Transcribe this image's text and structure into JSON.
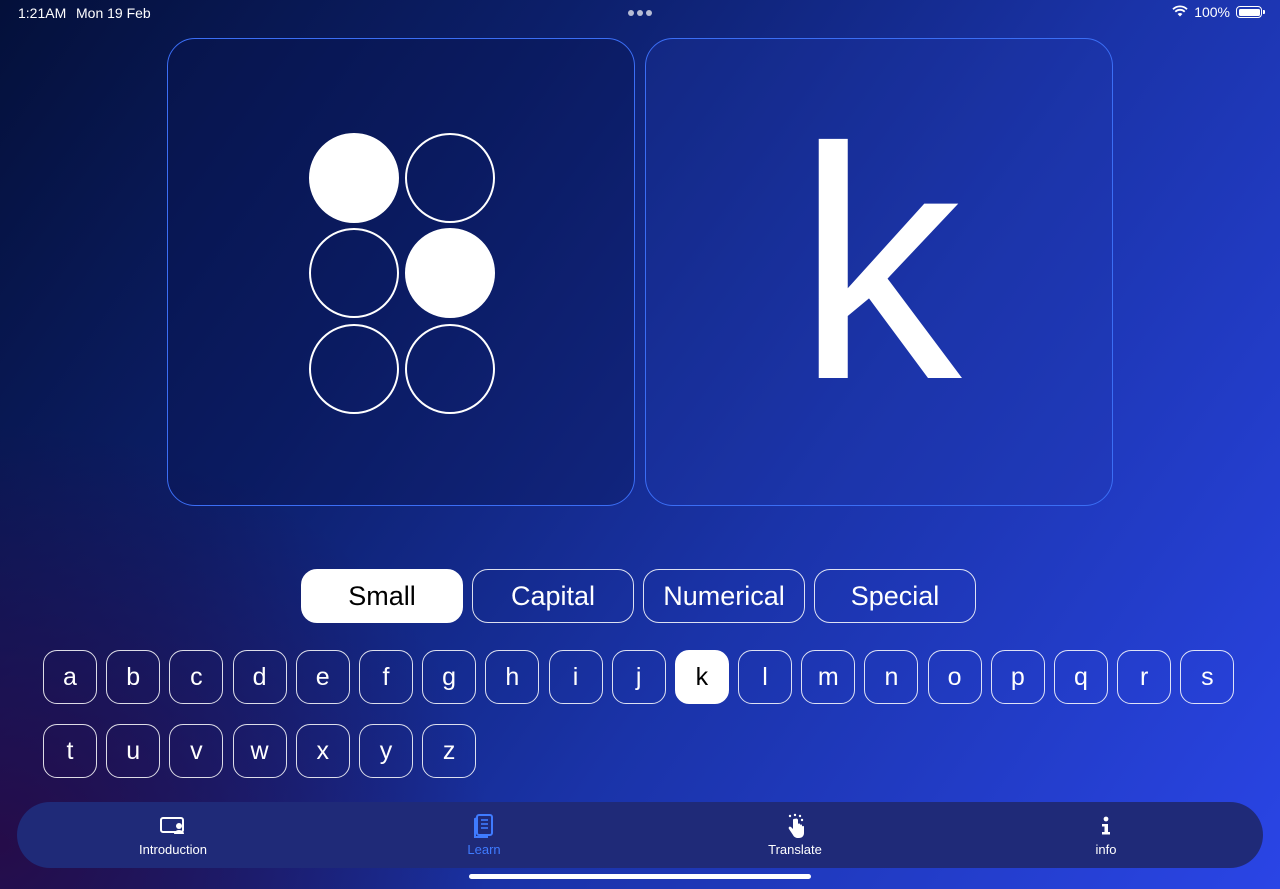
{
  "status_bar": {
    "time": "1:21AM",
    "date": "Mon 19 Feb",
    "battery": "100%",
    "icons": [
      "wifi-icon",
      "battery-icon"
    ]
  },
  "braille_cell": {
    "dots_filled": [
      true,
      false,
      false,
      false,
      true,
      false
    ]
  },
  "current_letter": "k",
  "categories": [
    {
      "label": "Small",
      "active": true
    },
    {
      "label": "Capital",
      "active": false
    },
    {
      "label": "Numerical",
      "active": false
    },
    {
      "label": "Special",
      "active": false
    }
  ],
  "letters": [
    "a",
    "b",
    "c",
    "d",
    "e",
    "f",
    "g",
    "h",
    "i",
    "j",
    "k",
    "l",
    "m",
    "n",
    "o",
    "p",
    "q",
    "r",
    "s",
    "t",
    "u",
    "v",
    "w",
    "x",
    "y",
    "z"
  ],
  "selected_letter": "k",
  "tabs": [
    {
      "label": "Introduction",
      "icon": "presentation-icon",
      "active": false
    },
    {
      "label": "Learn",
      "icon": "book-icon",
      "active": true
    },
    {
      "label": "Translate",
      "icon": "tap-hand-icon",
      "active": false
    },
    {
      "label": "info",
      "icon": "info-icon",
      "active": false
    }
  ],
  "colors": {
    "accent": "#3f7bff",
    "card_border": "#3b6ef5",
    "tabbar": "#1f2a78"
  }
}
